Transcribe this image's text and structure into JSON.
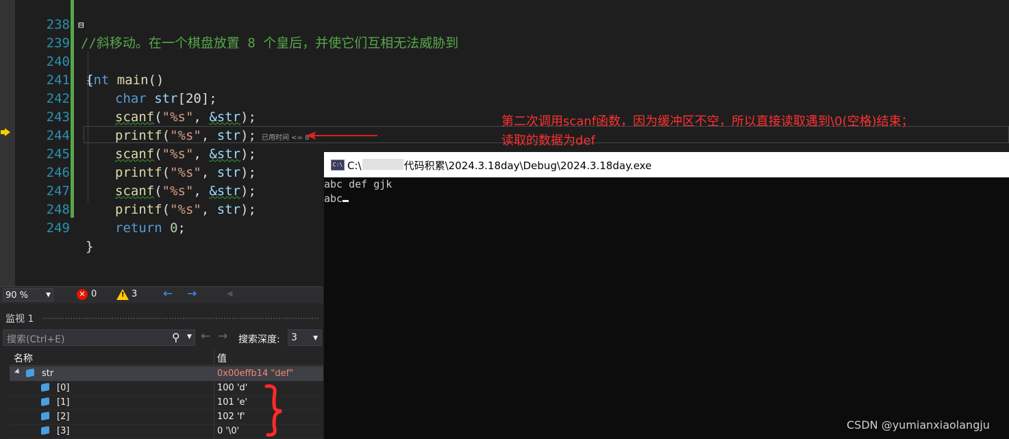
{
  "editor": {
    "lines": [
      {
        "num": "238",
        "text": "//斜移动。在一个棋盘放置 8 个皇后，并使它们互相无法威胁到"
      },
      {
        "num": "239",
        "collapse": "⊟"
      },
      {
        "num": "240"
      },
      {
        "num": "241"
      },
      {
        "num": "242"
      },
      {
        "num": "243"
      },
      {
        "num": "244"
      },
      {
        "num": "245"
      },
      {
        "num": "246"
      },
      {
        "num": "247"
      },
      {
        "num": "248"
      },
      {
        "num": "249"
      }
    ],
    "tokens": {
      "int": "int",
      "main": "main",
      "parens": "()",
      "lbrace": "{",
      "rbrace": "}",
      "char": "char",
      "str": "str",
      "arr": "[20];",
      "scanf": "scanf",
      "printf": "printf",
      "fmt": "\"%s\"",
      "amp_str": "&str",
      "ret": "return",
      "zero": "0",
      "open": "(",
      "comma": ", ",
      "close": ");",
      "semi": ";"
    },
    "elapsed_hint": "已用时间 <= 8",
    "current_line": 245
  },
  "annotation": {
    "line1": "第二次调用scanf函数，因为缓冲区不空，所以直接读取遇到\\0(空格)结束；",
    "line2": "读取的数据为def"
  },
  "console": {
    "title_prefix": "C:\\",
    "title_suffix": "代码积累\\2024.3.18day\\Debug\\2024.3.18day.exe",
    "icon_text": "C:\\",
    "output_line1": "abc def gjk",
    "output_line2": "abc"
  },
  "statusbar": {
    "zoom": "90 %",
    "errors": "0",
    "warnings": "3"
  },
  "watch": {
    "title": "监视 1",
    "search_placeholder": "搜索(Ctrl+E)",
    "depth_label": "搜索深度:",
    "depth_value": "3",
    "col_name": "名称",
    "col_value": "值",
    "rows": [
      {
        "name": "str",
        "value": "0x00effb14 \"def\""
      },
      {
        "name": "[0]",
        "value": "100 'd'"
      },
      {
        "name": "[1]",
        "value": "101 'e'"
      },
      {
        "name": "[2]",
        "value": "102 'f'"
      },
      {
        "name": "[3]",
        "value": "0 '\\0'"
      }
    ]
  },
  "watermark": "CSDN @yumianxiaolangju",
  "colors": {
    "keyword": "#569cd6",
    "function": "#dcdcaa",
    "string": "#d69d85",
    "annotation": "#ff3030",
    "line_number": "#2b91af"
  }
}
